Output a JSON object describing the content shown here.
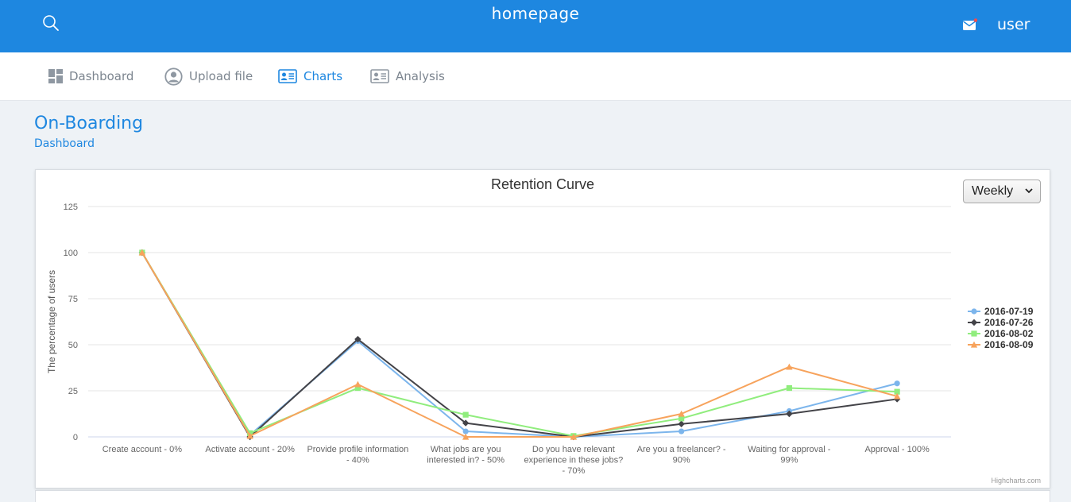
{
  "header": {
    "title": "homepage",
    "user_label": "user"
  },
  "nav": {
    "items": [
      {
        "label": "Dashboard",
        "icon": "dashboard-grid-icon"
      },
      {
        "label": "Upload file",
        "icon": "user-circle-icon"
      },
      {
        "label": "Charts",
        "icon": "id-card-icon"
      },
      {
        "label": "Analysis",
        "icon": "id-card-icon"
      }
    ],
    "active": "Charts"
  },
  "page": {
    "title": "On-Boarding",
    "breadcrumb": "Dashboard"
  },
  "period_select": {
    "value": "Weekly"
  },
  "credits": "Highcharts.com",
  "colors": {
    "header": "#1e87e0",
    "accent": "#1e87e0",
    "notification_dot": "#f04d4d"
  },
  "chart_data": {
    "type": "line",
    "title": "Retention Curve",
    "ylabel": "The percentage of users",
    "xlabel": "",
    "ylim": [
      0,
      125
    ],
    "yticks": [
      0,
      25,
      50,
      75,
      100,
      125
    ],
    "grid": true,
    "legend_position": "right",
    "categories": [
      "Create account - 0%",
      "Activate account - 20%",
      "Provide profile information - 40%",
      "What jobs are you interested in? - 50%",
      "Do you have relevant experience in these jobs? - 70%",
      "Are you a freelancer? - 90%",
      "Waiting for approval - 99%",
      "Approval - 100%"
    ],
    "category_lines": [
      [
        "Create account - 0%"
      ],
      [
        "Activate account - 20%"
      ],
      [
        "Provide profile information",
        "- 40%"
      ],
      [
        "What jobs are you",
        "interested in? - 50%"
      ],
      [
        "Do you have relevant",
        "experience in these jobs?",
        "- 70%"
      ],
      [
        "Are you a freelancer? -",
        "90%"
      ],
      [
        "Waiting for approval -",
        "99%"
      ],
      [
        "Approval - 100%"
      ]
    ],
    "series": [
      {
        "name": "2016-07-19",
        "color": "#7cb5ec",
        "marker": "circle",
        "values": [
          100,
          1,
          52,
          3,
          0,
          3,
          14,
          29
        ]
      },
      {
        "name": "2016-07-26",
        "color": "#434348",
        "marker": "diamond",
        "values": [
          100,
          0,
          53,
          7.5,
          0,
          7,
          12.5,
          20.5
        ]
      },
      {
        "name": "2016-08-02",
        "color": "#90ed7d",
        "marker": "square",
        "values": [
          100,
          2,
          26.5,
          12,
          0.5,
          10,
          26.5,
          24.5
        ]
      },
      {
        "name": "2016-08-09",
        "color": "#f7a35c",
        "marker": "triangle",
        "values": [
          100,
          0.5,
          28.5,
          0,
          0,
          12.5,
          38,
          22
        ]
      }
    ]
  }
}
